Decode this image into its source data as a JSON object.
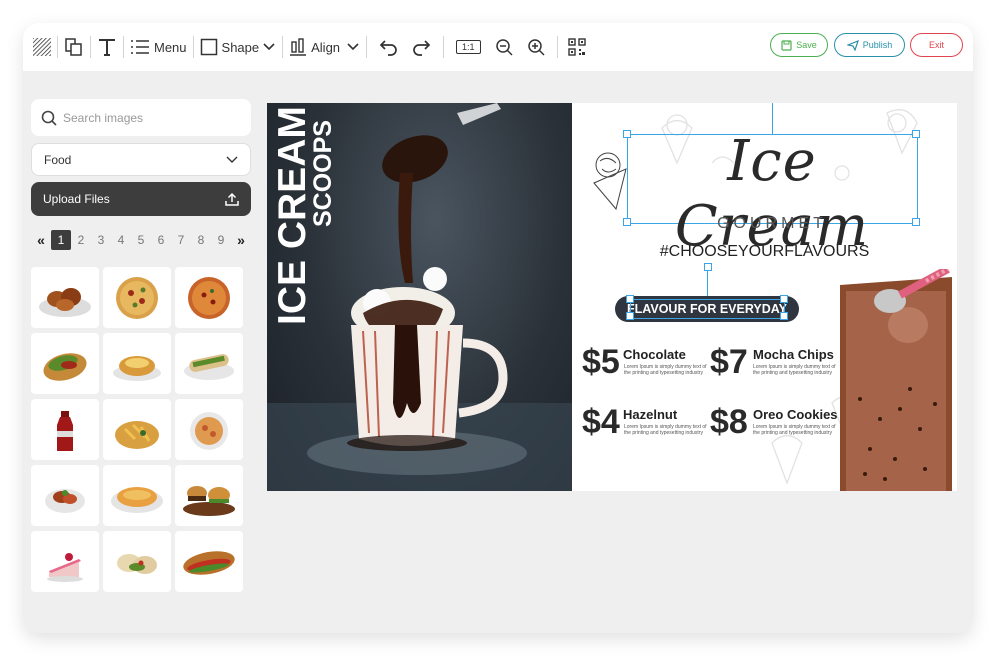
{
  "toolbar": {
    "menu_label": "Menu",
    "shape_label": "Shape",
    "align_label": "Align",
    "zoom_reset_label": "1:1",
    "save_label": "Save",
    "publish_label": "Publish",
    "exit_label": "Exit"
  },
  "sidebar": {
    "search_placeholder": "Search images",
    "category": "Food",
    "upload_label": "Upload Files",
    "pages": [
      "1",
      "2",
      "3",
      "4",
      "5",
      "6",
      "7",
      "8",
      "9"
    ],
    "prev": "«",
    "next": "»",
    "thumbnails": [
      "chicken-wings",
      "pizza",
      "pizza-2",
      "taco",
      "baked-potato",
      "sandwich-wrap",
      "cola-bottle",
      "fries-bowl",
      "pasta-bowl",
      "salad-plate",
      "omelette",
      "burgers",
      "cake-slice",
      "wraps",
      "sub-sandwich"
    ]
  },
  "design": {
    "vertical_title": "ICE CREAM",
    "vertical_subtitle": "SCOOPS",
    "script_title": "Ice Cream",
    "gourmet": "GOURMET",
    "hashtag": "#CHOOSEYOURFLAVOURS",
    "banner": "FLAVOUR FOR EVERYDAY",
    "items": [
      {
        "price": "$5",
        "name": "Chocolate",
        "desc": "Lorem Ipsum is simply dummy text of the printing and typesetting industry"
      },
      {
        "price": "$7",
        "name": "Mocha Chips",
        "desc": "Lorem Ipsum is simply dummy text of the printing and typesetting industry"
      },
      {
        "price": "$4",
        "name": "Hazelnut",
        "desc": "Lorem Ipsum is simply dummy text of the printing and typesetting industry"
      },
      {
        "price": "$8",
        "name": "Oreo Cookies",
        "desc": "Lorem Ipsum is simply dummy text of the printing and typesetting industry"
      }
    ]
  },
  "colors": {
    "save": "#4caf50",
    "publish": "#2a8fa8",
    "exit": "#e0454f",
    "selection": "#3aa6e8",
    "dark": "#3d3d3d"
  }
}
